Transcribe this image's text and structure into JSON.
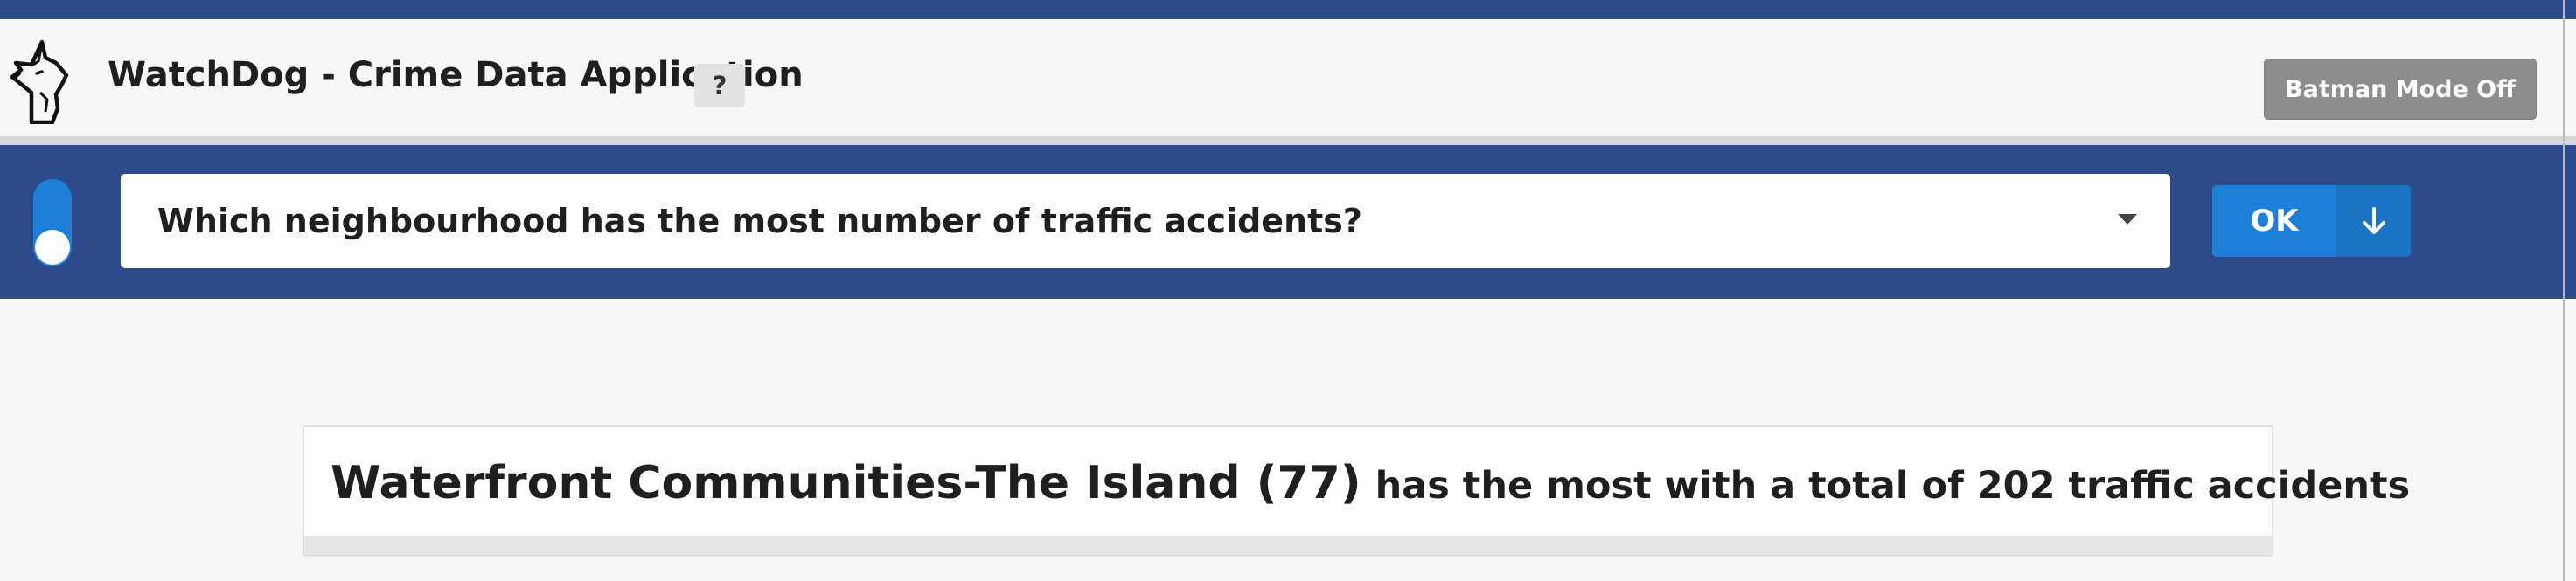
{
  "header": {
    "app_title": "WatchDog - Crime Data Application",
    "help_label": "?",
    "batman_mode_label": "Batman Mode Off",
    "logo_icon": "dog-head-icon"
  },
  "query": {
    "selected_question": "Which neighbourhood has the most number of traffic accidents?",
    "ok_label": "OK",
    "dropdown_icon": "arrow-down-icon",
    "toggle_state": "off"
  },
  "result": {
    "neighbourhood": "Waterfront Communities-The Island (77)",
    "summary": "has the most with a total of 202 traffic accidents"
  },
  "colors": {
    "header_bar": "#2d4a8a",
    "accent_blue": "#1e7fd6",
    "batman_button": "#8d8d8d",
    "page_bg": "#f7f7f7"
  }
}
